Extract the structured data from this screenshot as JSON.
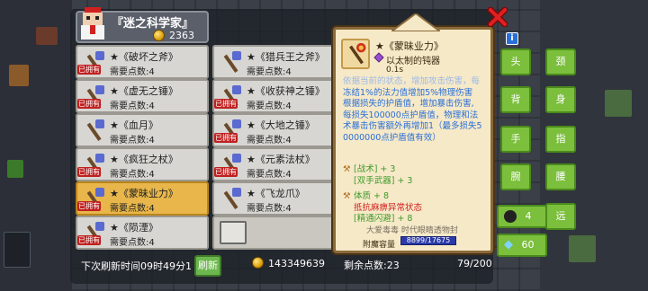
{
  "header": {
    "title": "『迷之科学家』",
    "coins": "2363"
  },
  "items": [
    {
      "name": "★《破坏之斧》",
      "req": "需要点数:4",
      "badge": "已拥有"
    },
    {
      "name": "★《猎兵王之斧》",
      "req": "需要点数:4",
      "badge": ""
    },
    {
      "name": "★《虚无之锤》",
      "req": "需要点数:4",
      "badge": "已拥有"
    },
    {
      "name": "★《收获神之锤》",
      "req": "需要点数:4",
      "badge": "已拥有"
    },
    {
      "name": "★《血月》",
      "req": "需要点数:4",
      "badge": ""
    },
    {
      "name": "★《大地之锤》",
      "req": "需要点数:4",
      "badge": "已拥有"
    },
    {
      "name": "★《疯狂之杖》",
      "req": "需要点数:4",
      "badge": "已拥有"
    },
    {
      "name": "★《元素法杖》",
      "req": "需要点数:4",
      "badge": "已拥有"
    },
    {
      "name": "★《蒙昧业力》",
      "req": "需要点数:4",
      "badge": "已拥有",
      "selected": true
    },
    {
      "name": "★《飞龙爪》",
      "req": "需要点数:4",
      "badge": ""
    },
    {
      "name": "★《陨湮》",
      "req": "需要点数:4",
      "badge": "已拥有"
    }
  ],
  "bottom": {
    "refresh_text": "下次刷新时间09时49分1",
    "refresh_button": "刷新",
    "money": "143349639",
    "points_label": "剩余点数:23",
    "capacity": "79/200"
  },
  "tooltip": {
    "name": "★《蒙昧业力》",
    "type": "以太制的钝器",
    "cooldown": "0.1s",
    "desc_faded": "依据当前的状态，增加攻击伤害，每",
    "desc": [
      "冻结1%的法力值增加5%物理伤害",
      "根据损失的护盾值，增加暴击伤害,",
      "每损失100000点护盾值，物理和法",
      "术暴击伤害额外再增加1（最多损失5",
      "0000000点护盾值有效）"
    ],
    "stats": [
      {
        "text": "[战术] + 3",
        "color": "green"
      },
      {
        "text": "[双手武器] + 3",
        "color": "green"
      },
      {
        "text": "体质 + 8",
        "color": "green"
      },
      {
        "text": "抵抗麻痹异常状态",
        "color": "red"
      },
      {
        "text": "[精通闪避] + 8",
        "color": "green"
      }
    ],
    "footer_faded": "大爱毒毒  时代眼睛透物封",
    "capacity_label": "附魔容量",
    "capacity_value": "8899/17675"
  },
  "equipment_slots": [
    "头",
    "颈",
    "背",
    "身",
    "手",
    "指",
    "腕",
    "腰",
    "远"
  ],
  "resources": {
    "character_count": "4",
    "gems": "60"
  },
  "colors": {
    "card_bg": "#d7d6d2",
    "card_selected": "#e8b64a",
    "slot_green": "#7bbf3c",
    "tooltip_bg": "#f6e9c8",
    "text_blue": "#2a6fd8",
    "text_green": "#3f9a2a",
    "text_red": "#d02020"
  }
}
